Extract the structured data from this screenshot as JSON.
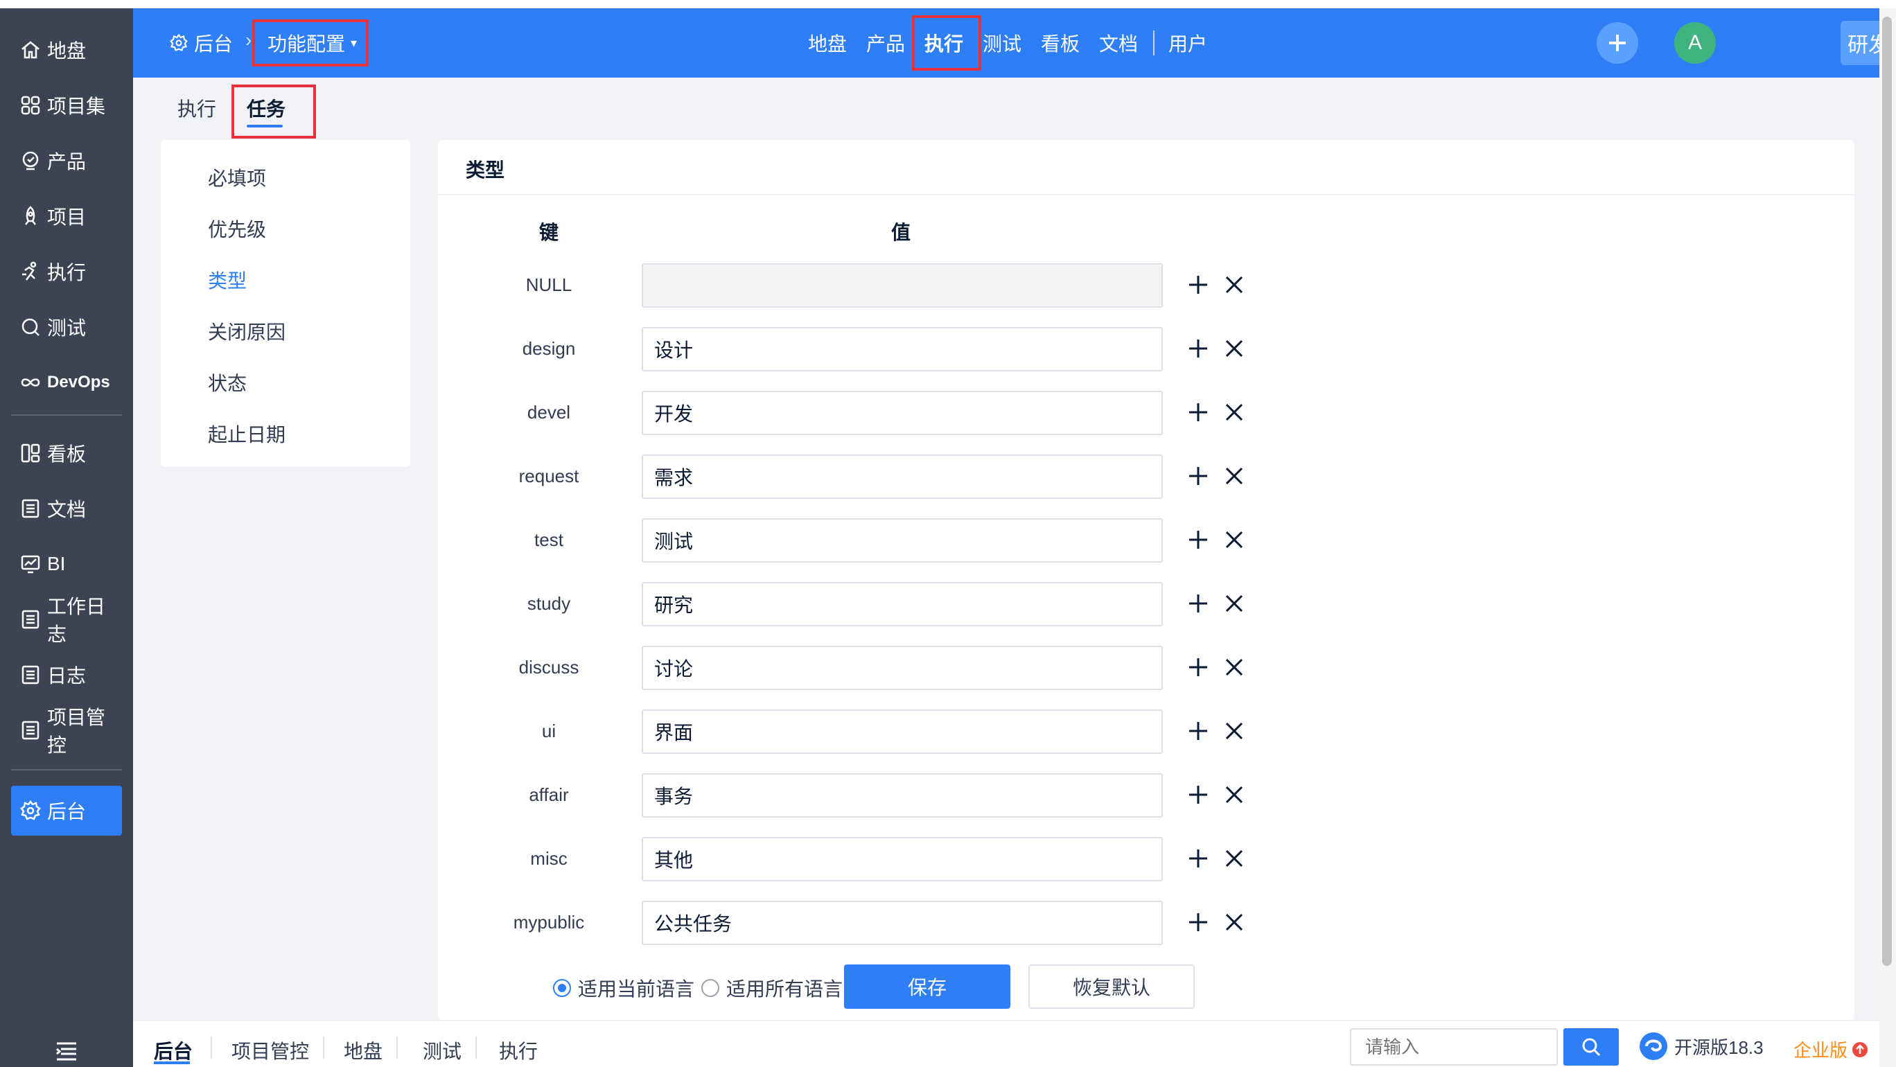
{
  "sidebar": {
    "items": [
      {
        "label": "地盘",
        "icon": "home-icon"
      },
      {
        "label": "项目集",
        "icon": "grid-icon"
      },
      {
        "label": "产品",
        "icon": "product-icon"
      },
      {
        "label": "项目",
        "icon": "rocket-icon"
      },
      {
        "label": "执行",
        "icon": "run-icon"
      },
      {
        "label": "测试",
        "icon": "test-search-icon"
      },
      {
        "label": "DevOps",
        "icon": "infinity-icon"
      },
      {
        "label": "看板",
        "icon": "kanban-icon"
      },
      {
        "label": "文档",
        "icon": "doc-icon"
      },
      {
        "label": "BI",
        "icon": "chart-icon"
      },
      {
        "label": "工作日志",
        "icon": "list-icon"
      },
      {
        "label": "日志",
        "icon": "list-icon"
      },
      {
        "label": "项目管控",
        "icon": "list-icon"
      },
      {
        "label": "后台",
        "icon": "gear-icon"
      }
    ],
    "active": "后台"
  },
  "header": {
    "crumb_home": "后台",
    "crumb_current": "功能配置",
    "nav": [
      "地盘",
      "产品",
      "执行",
      "测试",
      "看板",
      "文档",
      "用户"
    ],
    "active_nav": "执行",
    "avatar_letter": "A",
    "switch_button": "研发综合界面"
  },
  "subtabs": [
    "执行",
    "任务"
  ],
  "active_subtab": "任务",
  "settings_menu": [
    "必填项",
    "优先级",
    "类型",
    "关闭原因",
    "状态",
    "起止日期"
  ],
  "active_menu": "类型",
  "card": {
    "title": "类型",
    "col_key": "键",
    "col_value": "值",
    "rows": [
      {
        "key": "NULL",
        "value": ""
      },
      {
        "key": "design",
        "value": "设计"
      },
      {
        "key": "devel",
        "value": "开发"
      },
      {
        "key": "request",
        "value": "需求"
      },
      {
        "key": "test",
        "value": "测试"
      },
      {
        "key": "study",
        "value": "研究"
      },
      {
        "key": "discuss",
        "value": "讨论"
      },
      {
        "key": "ui",
        "value": "界面"
      },
      {
        "key": "affair",
        "value": "事务"
      },
      {
        "key": "misc",
        "value": "其他"
      },
      {
        "key": "mypublic",
        "value": "公共任务"
      }
    ],
    "radio_current": "适用当前语言",
    "radio_all": "适用所有语言",
    "radio_selected": "适用当前语言",
    "save": "保存",
    "reset": "恢复默认"
  },
  "footer": {
    "items": [
      "后台",
      "项目管控",
      "地盘",
      "测试",
      "执行"
    ],
    "active": "后台",
    "search_placeholder": "请输入",
    "version": "开源版18.3",
    "enterprise": "企业版"
  },
  "colors": {
    "primary": "#2e7ff5",
    "sidebar": "#3c4353",
    "highlight": "#e5323e",
    "enterprise": "#ff8c1a",
    "avatar": "#3fb37f"
  }
}
